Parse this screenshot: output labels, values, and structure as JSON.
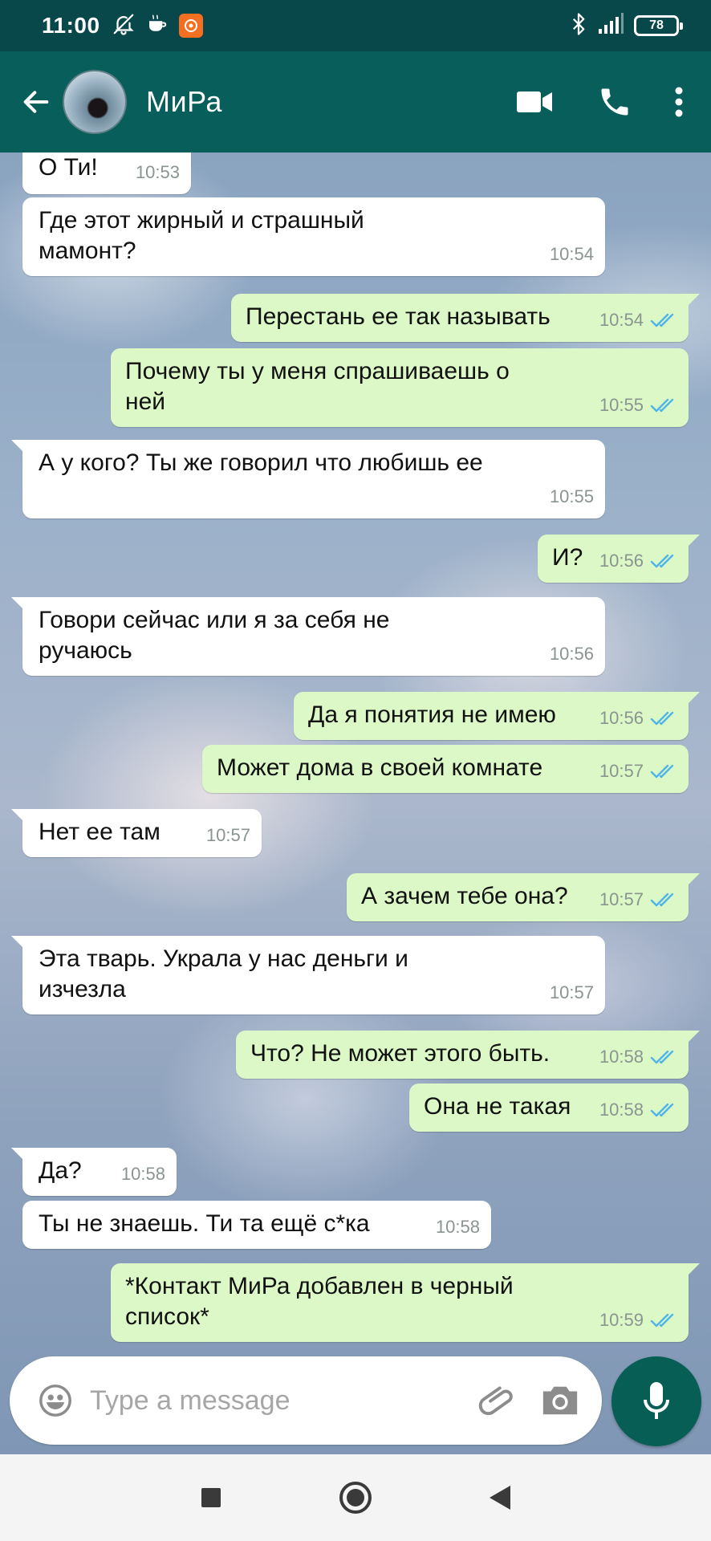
{
  "status_bar": {
    "time": "11:00",
    "battery": "78"
  },
  "header": {
    "contact_name": "МиРа"
  },
  "messages": [
    {
      "dir": "in",
      "text": "О Ти!",
      "time": "10:53"
    },
    {
      "dir": "in",
      "text": "Где этот жирный и страшный мамонт?",
      "time": "10:54"
    },
    {
      "dir": "out",
      "text": "Перестань ее так называть",
      "time": "10:54"
    },
    {
      "dir": "out",
      "text": "Почему ты у меня спрашиваешь о ней",
      "time": "10:55"
    },
    {
      "dir": "in",
      "text": "А у кого? Ты же говорил что любишь ее",
      "time": "10:55"
    },
    {
      "dir": "out",
      "text": "И?",
      "time": "10:56"
    },
    {
      "dir": "in",
      "text": "Говори сейчас или я за себя не ручаюсь",
      "time": "10:56"
    },
    {
      "dir": "out",
      "text": "Да я понятия не имею",
      "time": "10:56"
    },
    {
      "dir": "out",
      "text": "Может дома в своей комнате",
      "time": "10:57"
    },
    {
      "dir": "in",
      "text": "Нет ее там",
      "time": "10:57"
    },
    {
      "dir": "out",
      "text": "А зачем тебе она?",
      "time": "10:57"
    },
    {
      "dir": "in",
      "text": "Эта тварь. Украла у нас деньги и изчезла",
      "time": "10:57"
    },
    {
      "dir": "out",
      "text": "Что? Не может этого быть.",
      "time": "10:58"
    },
    {
      "dir": "out",
      "text": "Она не такая",
      "time": "10:58"
    },
    {
      "dir": "in",
      "text": "Да?",
      "time": "10:58"
    },
    {
      "dir": "in",
      "text": "Ты не знаешь. Ти та ещё с*ка",
      "time": "10:58"
    },
    {
      "dir": "out",
      "text": "*Контакт МиРа добавлен в черный список*",
      "time": "10:59"
    }
  ],
  "composer": {
    "placeholder": "Type a message"
  },
  "colors": {
    "header": "#075e5a",
    "status_bar": "#08474a",
    "outgoing_bubble": "#dcf8c6",
    "incoming_bubble": "#ffffff",
    "read_ticks": "#4fb5e8",
    "mic_button": "#075e54"
  },
  "icons": {
    "status": [
      "mute-bell-icon",
      "coffee-icon",
      "app-notification-icon",
      "bluetooth-icon",
      "signal-icon",
      "battery-icon"
    ],
    "header": [
      "back-arrow-icon",
      "video-call-icon",
      "phone-icon",
      "more-vert-icon"
    ],
    "composer": [
      "emoji-icon",
      "attach-icon",
      "camera-icon",
      "mic-icon"
    ],
    "nav": [
      "recents-square-icon",
      "home-circle-icon",
      "back-triangle-icon"
    ]
  }
}
